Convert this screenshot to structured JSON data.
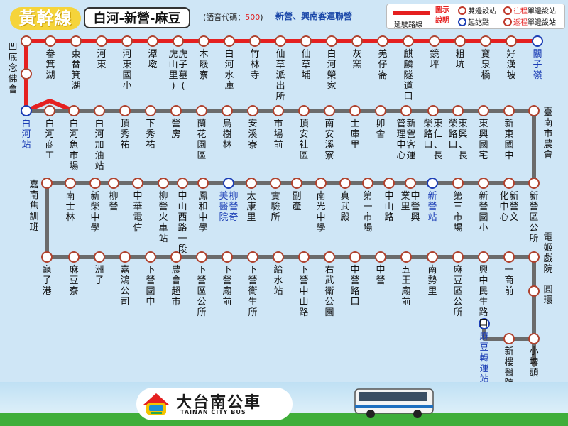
{
  "header": {
    "line_name": "黃幹線",
    "route_name": "白河-新營-麻豆",
    "voice_code_label": "語音代碼：",
    "voice_code": "500",
    "operators": "新營、興南客運聯營"
  },
  "legend": {
    "extension_label": "延駛路線",
    "legend_title_1": "圖示",
    "legend_title_2": "說明",
    "both_ways": "雙邊設站",
    "terminal": "起訖點",
    "outbound_prefix": "往程",
    "outbound_suffix": "單邊設站",
    "return_prefix": "返程",
    "return_suffix": "單邊設站"
  },
  "colors": {
    "extension_red": "#e52020",
    "route_gray": "#6b6b6b",
    "stop_ring": "#b0432f",
    "terminal_blue": "#1c3eb5",
    "line_yellow": "#f5d43b"
  },
  "rows": [
    {
      "stops": [
        {
          "name": "凹底",
          "blue": false
        },
        {
          "name": "念佛會",
          "blue": false
        },
        {
          "name": "畚箕湖",
          "blue": false
        },
        {
          "name": "東畚箕湖",
          "blue": false
        },
        {
          "name": "河東",
          "blue": false
        },
        {
          "name": "河東國小",
          "blue": false
        },
        {
          "name": "潭墘",
          "blue": false
        },
        {
          "name": "虎子墓(虎山里)",
          "blue": false
        },
        {
          "name": "木屐寮",
          "blue": false
        },
        {
          "name": "白河水庫",
          "blue": false
        },
        {
          "name": "竹林寺",
          "blue": false
        },
        {
          "name": "仙草派出所",
          "blue": false
        },
        {
          "name": "仙草埔",
          "blue": false
        },
        {
          "name": "白河榮家",
          "blue": false
        },
        {
          "name": "灰窯",
          "blue": false
        },
        {
          "name": "羌仔崙",
          "blue": false
        },
        {
          "name": "麒麟隧道口",
          "blue": false
        },
        {
          "name": "鏡坪",
          "blue": false
        },
        {
          "name": "粗坑",
          "blue": false
        },
        {
          "name": "寶泉橋",
          "blue": false
        },
        {
          "name": "好漢坡",
          "blue": false
        },
        {
          "name": "關子嶺",
          "blue": true
        }
      ]
    },
    {
      "stops": [
        {
          "name": "白河站",
          "blue": true
        },
        {
          "name": "白河商工",
          "blue": false
        },
        {
          "name": "白河魚市場",
          "blue": false
        },
        {
          "name": "白河加油站",
          "blue": false
        },
        {
          "name": "頂秀祐",
          "blue": false
        },
        {
          "name": "下秀祐",
          "blue": false
        },
        {
          "name": "營房",
          "blue": false
        },
        {
          "name": "蘭花園區",
          "blue": false
        },
        {
          "name": "烏樹林",
          "blue": false
        },
        {
          "name": "安溪寮",
          "blue": false
        },
        {
          "name": "市場前",
          "blue": false
        },
        {
          "name": "頂安社區",
          "blue": false
        },
        {
          "name": "南安溪寮",
          "blue": false
        },
        {
          "name": "土庫里",
          "blue": false
        },
        {
          "name": "卯舍",
          "blue": false
        },
        {
          "name": "新營客運管理中心",
          "blue": false
        },
        {
          "name": "東仁、長榮路口",
          "blue": false
        },
        {
          "name": "東興、長榮路口",
          "blue": false
        },
        {
          "name": "東興國宅",
          "blue": false
        },
        {
          "name": "新東國中",
          "blue": false
        },
        {
          "name": "臺南市農會",
          "blue": false
        }
      ]
    },
    {
      "stops": [
        {
          "name": "嘉南焦訓班",
          "blue": false
        },
        {
          "name": "南士林",
          "blue": false
        },
        {
          "name": "新榮中學",
          "blue": false
        },
        {
          "name": "柳營",
          "blue": false
        },
        {
          "name": "中華電信",
          "blue": false
        },
        {
          "name": "柳營火車站",
          "blue": false
        },
        {
          "name": "中山西路一段",
          "blue": false
        },
        {
          "name": "鳳和中學",
          "blue": false
        },
        {
          "name": "柳營奇美醫院",
          "blue": true
        },
        {
          "name": "太康里",
          "blue": false
        },
        {
          "name": "實驗所",
          "blue": false
        },
        {
          "name": "副產",
          "blue": false
        },
        {
          "name": "南光中學",
          "blue": false
        },
        {
          "name": "真武殿",
          "blue": false
        },
        {
          "name": "第一市場",
          "blue": false
        },
        {
          "name": "中山路",
          "blue": false
        },
        {
          "name": "中營興業里",
          "blue": false
        },
        {
          "name": "新營站",
          "blue": true
        },
        {
          "name": "第三市場",
          "blue": false
        },
        {
          "name": "新營國小",
          "blue": false
        },
        {
          "name": "新營文化中心",
          "blue": false
        },
        {
          "name": "新營區公所",
          "blue": false
        }
      ]
    },
    {
      "stops": [
        {
          "name": "龜子港",
          "blue": false
        },
        {
          "name": "麻豆寮",
          "blue": false
        },
        {
          "name": "洲子",
          "blue": false
        },
        {
          "name": "嘉鴻公司",
          "blue": false
        },
        {
          "name": "下營國中",
          "blue": false
        },
        {
          "name": "農會超市",
          "blue": false
        },
        {
          "name": "下營區公所",
          "blue": false
        },
        {
          "name": "下營廟前",
          "blue": false
        },
        {
          "name": "下營衛生所",
          "blue": false
        },
        {
          "name": "給水站",
          "blue": false
        },
        {
          "name": "下營中山路",
          "blue": false
        },
        {
          "name": "右武衛公園",
          "blue": false
        },
        {
          "name": "中營路口",
          "blue": false
        },
        {
          "name": "中營",
          "blue": false
        },
        {
          "name": "五王廟前",
          "blue": false
        },
        {
          "name": "南勢里",
          "blue": false
        },
        {
          "name": "麻豆區公所",
          "blue": false
        },
        {
          "name": "興中民生路口",
          "blue": false
        },
        {
          "name": "一商前",
          "blue": false
        },
        {
          "name": "電姬戲院",
          "blue": false
        }
      ]
    },
    {
      "stops": [
        {
          "name": "麻豆轉運站",
          "blue": true
        },
        {
          "name": "新樓醫院",
          "blue": false
        },
        {
          "name": "小埤頭",
          "blue": false
        }
      ]
    }
  ],
  "loop_label": "圓環",
  "footer": {
    "logo_text": "大台南公車",
    "logo_subtext": "TAINAN CITY BUS"
  }
}
